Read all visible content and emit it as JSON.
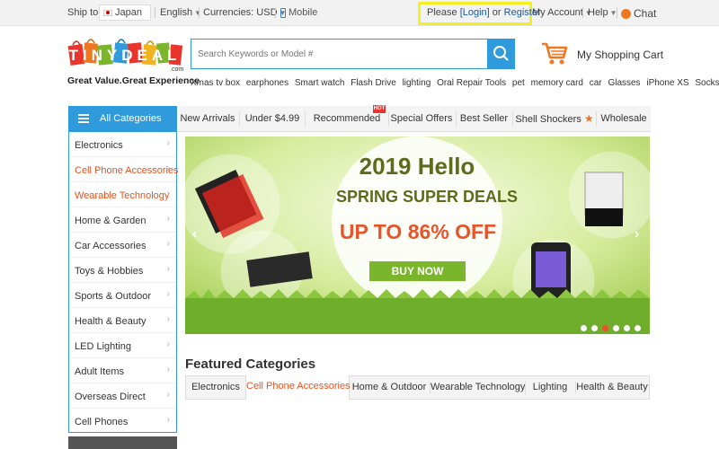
{
  "topbar": {
    "ship_label": "Ship to:",
    "country": "Japan",
    "language": "English",
    "currency": "Currencies: USD",
    "mobile": "Mobile",
    "please": "Please",
    "login": "[Login]",
    "or": "or",
    "register": "Register",
    "account": "My Account",
    "help": "Help",
    "chat": "Chat"
  },
  "logo": {
    "brand": "TINYDEAL",
    "domain_suffix": ".com",
    "tagline": "Great Value.Great Experience"
  },
  "search": {
    "placeholder": "Search Keywords or Model #",
    "hot_keywords": [
      "Xmas tv box",
      "earphones",
      "Smart watch",
      "Flash Drive",
      "lighting",
      "Oral Repair Tools",
      "pet",
      "memory card",
      "car",
      "Glasses",
      "iPhone XS",
      "Socks"
    ]
  },
  "cart": {
    "label": "My Shopping Cart"
  },
  "categories": {
    "header": "All Categories",
    "items": [
      {
        "label": "Electronics"
      },
      {
        "label": "Cell Phone Accessories"
      },
      {
        "label": "Wearable Technology"
      },
      {
        "label": "Home & Garden"
      },
      {
        "label": "Car Accessories"
      },
      {
        "label": "Toys & Hobbies"
      },
      {
        "label": "Sports & Outdoor"
      },
      {
        "label": "Health & Beauty"
      },
      {
        "label": "LED Lighting"
      },
      {
        "label": "Adult Items"
      },
      {
        "label": "Overseas Direct"
      },
      {
        "label": "Cell Phones"
      }
    ]
  },
  "nav": {
    "tabs": [
      {
        "label": "New Arrivals"
      },
      {
        "label": "Under $4.99"
      },
      {
        "label": "Recommended"
      },
      {
        "label": "Special Offers"
      },
      {
        "label": "Best Seller"
      },
      {
        "label": "Shell Shockers"
      },
      {
        "label": "Wholesale"
      }
    ],
    "hot_badge": "HOT"
  },
  "banner": {
    "line1": "2019 Hello",
    "line2": "SPRING SUPER DEALS",
    "line3": "UP TO 86% OFF",
    "button": "BUY NOW",
    "slide_count": 6,
    "active_slide": 3
  },
  "featured": {
    "title": "Featured Categories",
    "tabs": [
      "Electronics",
      "Cell Phone Accessories",
      "Home & Outdoor",
      "Wearable Technology",
      "Lighting",
      "Health & Beauty"
    ],
    "active_tab": 1
  },
  "colors": {
    "accent_blue": "#2f9bdc",
    "accent_orange": "#e2531e",
    "highlight_yellow": "#f2ef22",
    "banner_green": "#7bb52b"
  }
}
